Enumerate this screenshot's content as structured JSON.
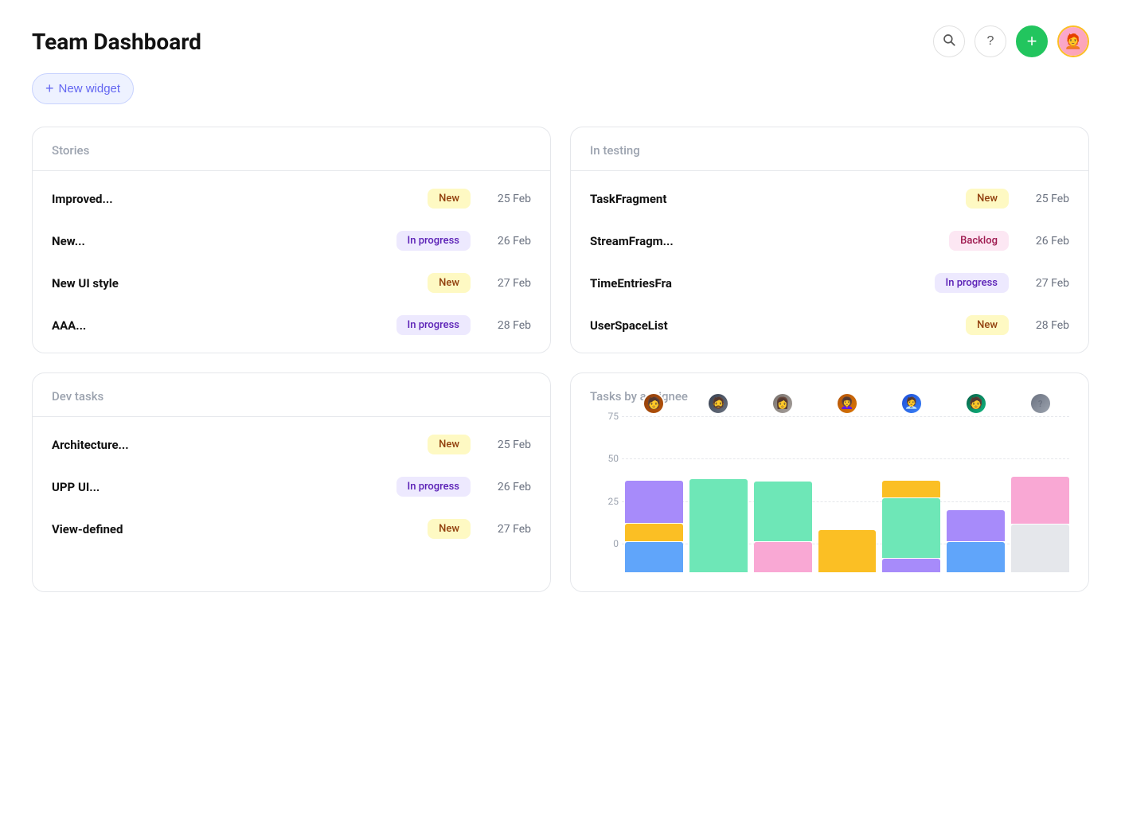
{
  "header": {
    "title": "Team Dashboard",
    "new_widget_label": "New widget",
    "actions": {
      "search_title": "Search",
      "help_title": "Help",
      "add_title": "Add",
      "add_icon": "+"
    }
  },
  "stories_card": {
    "title": "Stories",
    "rows": [
      {
        "name": "Improved...",
        "badge": "New",
        "badge_type": "new",
        "date": "25 Feb"
      },
      {
        "name": "New...",
        "badge": "In progress",
        "badge_type": "in-progress",
        "date": "26 Feb"
      },
      {
        "name": "New UI style",
        "badge": "New",
        "badge_type": "new",
        "date": "27 Feb"
      },
      {
        "name": "AAA...",
        "badge": "In progress",
        "badge_type": "in-progress",
        "date": "28 Feb"
      }
    ]
  },
  "in_testing_card": {
    "title": "In testing",
    "rows": [
      {
        "name": "TaskFragment",
        "badge": "New",
        "badge_type": "new",
        "date": "25 Feb"
      },
      {
        "name": "StreamFragm...",
        "badge": "Backlog",
        "badge_type": "backlog",
        "date": "26 Feb"
      },
      {
        "name": "TimeEntriesFra",
        "badge": "In progress",
        "badge_type": "in-progress",
        "date": "27 Feb"
      },
      {
        "name": "UserSpaceList",
        "badge": "New",
        "badge_type": "new",
        "date": "28 Feb"
      }
    ]
  },
  "dev_tasks_card": {
    "title": "Dev tasks",
    "rows": [
      {
        "name": "Architecture...",
        "badge": "New",
        "badge_type": "new",
        "date": "25 Feb"
      },
      {
        "name": "UPP UI...",
        "badge": "In progress",
        "badge_type": "in-progress",
        "date": "26 Feb"
      },
      {
        "name": "View-defined",
        "badge": "New",
        "badge_type": "new",
        "date": "27 Feb"
      }
    ]
  },
  "chart_card": {
    "title": "Tasks by assignee",
    "y_labels": [
      "75",
      "50",
      "25",
      "0"
    ],
    "bar_groups": [
      {
        "avatar_bg": "#d97706",
        "avatar_text": "👤",
        "avatar_color": "#7c3aed",
        "segments": [
          {
            "color": "#a78bfa",
            "height_pct": 25
          },
          {
            "color": "#fbbf24",
            "height_pct": 10
          },
          {
            "color": "#6ee7b7",
            "height_pct": 0
          },
          {
            "color": "#60a5fa",
            "height_pct": 30
          }
        ]
      },
      {
        "avatar_bg": "#374151",
        "avatar_text": "👤",
        "avatar_color": "#059669",
        "segments": [
          {
            "color": "#a78bfa",
            "height_pct": 5
          },
          {
            "color": "#fbbf24",
            "height_pct": 0
          },
          {
            "color": "#6ee7b7",
            "height_pct": 55
          },
          {
            "color": "#60a5fa",
            "height_pct": 0
          }
        ]
      },
      {
        "avatar_bg": "#78716c",
        "avatar_text": "👤",
        "avatar_color": "#ec4899",
        "segments": [
          {
            "color": "#a78bfa",
            "height_pct": 0
          },
          {
            "color": "#fbbf24",
            "height_pct": 0
          },
          {
            "color": "#6ee7b7",
            "height_pct": 35
          },
          {
            "color": "#f9a8d4",
            "height_pct": 20
          }
        ]
      },
      {
        "avatar_bg": "#b45309",
        "avatar_text": "👤",
        "avatar_color": "#f59e0b",
        "segments": [
          {
            "color": "#a78bfa",
            "height_pct": 0
          },
          {
            "color": "#fbbf24",
            "height_pct": 25
          },
          {
            "color": "#6ee7b7",
            "height_pct": 0
          },
          {
            "color": "#60a5fa",
            "height_pct": 0
          }
        ]
      },
      {
        "avatar_bg": "#4b5563",
        "avatar_text": "👤",
        "avatar_color": "#10b981",
        "segments": [
          {
            "color": "#a78bfa",
            "height_pct": 0
          },
          {
            "color": "#fbbf24",
            "height_pct": 10
          },
          {
            "color": "#6ee7b7",
            "height_pct": 35
          },
          {
            "color": "#60a5fa",
            "height_pct": 10
          }
        ]
      },
      {
        "avatar_bg": "#92400e",
        "avatar_text": "👤",
        "avatar_color": "#6366f1",
        "segments": [
          {
            "color": "#a78bfa",
            "height_pct": 18
          },
          {
            "color": "#fbbf24",
            "height_pct": 0
          },
          {
            "color": "#6ee7b7",
            "height_pct": 0
          },
          {
            "color": "#60a5fa",
            "height_pct": 18
          }
        ]
      },
      {
        "avatar_bg": "#6b7280",
        "avatar_text": "?",
        "avatar_color": "#9ca3af",
        "segments": [
          {
            "color": "#f9a8d4",
            "height_pct": 28
          },
          {
            "color": "#e5e7eb",
            "height_pct": 30
          },
          {
            "color": "#60a5fa",
            "height_pct": 8
          }
        ]
      }
    ]
  }
}
